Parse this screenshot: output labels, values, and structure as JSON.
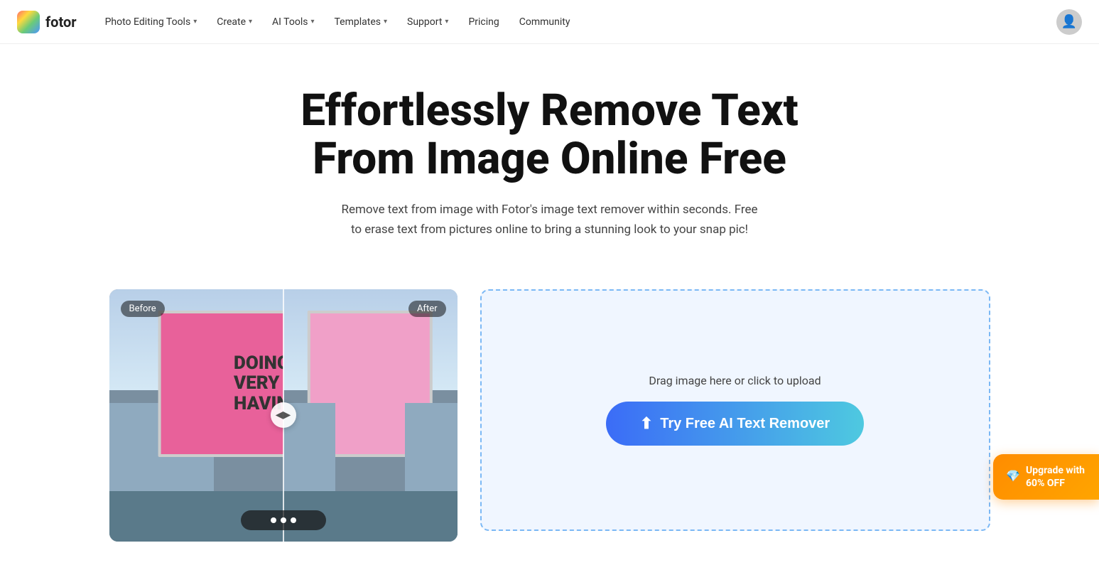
{
  "brand": {
    "name": "fotor",
    "logo_alt": "Fotor logo"
  },
  "nav": {
    "items": [
      {
        "label": "Photo Editing Tools",
        "has_dropdown": true
      },
      {
        "label": "Create",
        "has_dropdown": true
      },
      {
        "label": "AI Tools",
        "has_dropdown": true
      },
      {
        "label": "Templates",
        "has_dropdown": true
      },
      {
        "label": "Support",
        "has_dropdown": true
      },
      {
        "label": "Pricing",
        "has_dropdown": false
      },
      {
        "label": "Community",
        "has_dropdown": false
      }
    ]
  },
  "hero": {
    "title": "Effortlessly Remove Text From Image Online Free",
    "subtitle": "Remove text from image with Fotor's image text remover within seconds. Free to erase text from pictures online to bring a stunning look to your snap pic!"
  },
  "before_after": {
    "before_label": "Before",
    "after_label": "After",
    "billboard_lines": [
      "DOING N",
      "VERY DIFFE",
      "HAVING NO"
    ]
  },
  "upload": {
    "hint": "Drag image here or click to upload",
    "button_label": "Try Free AI Text Remover"
  },
  "upgrade": {
    "label": "Upgrade with",
    "discount": "60% OFF"
  }
}
